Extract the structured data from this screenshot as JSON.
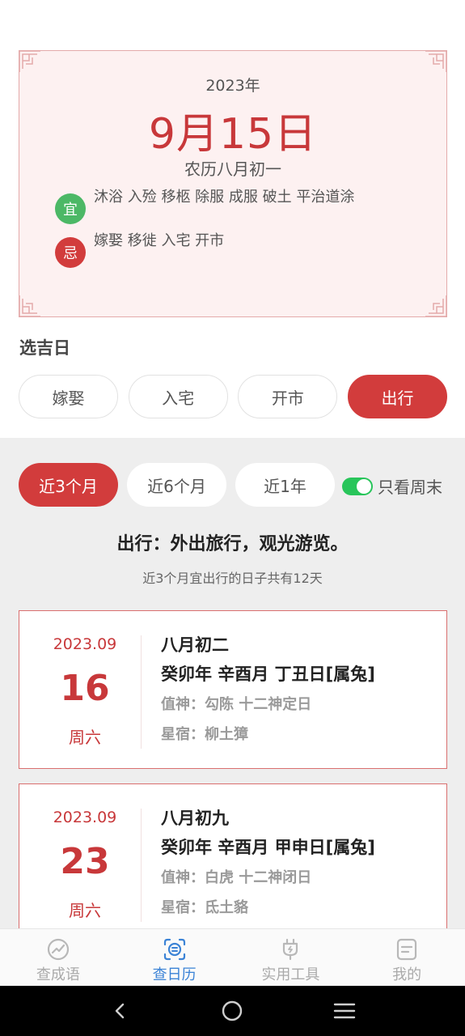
{
  "calendar": {
    "year": "2023年",
    "date": "9月15日",
    "lunar": "农历八月初一",
    "yi_label": "宜",
    "yi_text": "沐浴 入殓 移柩 除服 成服 破土 平治道涂",
    "ji_label": "忌",
    "ji_text": "嫁娶 移徙 入宅 开市"
  },
  "choose": {
    "title": "选吉日",
    "categories": [
      "嫁娶",
      "入宅",
      "开市",
      "出行"
    ],
    "active_category": "出行"
  },
  "filter": {
    "ranges": [
      "近3个月",
      "近6个月",
      "近1年"
    ],
    "active_range": "近3个月",
    "weekend_only_label": "只看周末",
    "weekend_only": true
  },
  "result": {
    "headline": "出行：外出旅行，观光游览。",
    "summary": "近3个月宜出行的日子共有12天"
  },
  "days": [
    {
      "month": "2023.09",
      "day": "16",
      "weekday": "周六",
      "lunar": "八月初二",
      "ganzhi": "癸卯年 辛酉月 丁丑日[属兔]",
      "shen": "值神：勾陈   十二神定日",
      "xiu": "星宿：柳土獐"
    },
    {
      "month": "2023.09",
      "day": "23",
      "weekday": "周六",
      "lunar": "八月初九",
      "ganzhi": "癸卯年 辛酉月 甲申日[属兔]",
      "shen": "值神：白虎   十二神闭日",
      "xiu": "星宿：氐土貉"
    }
  ],
  "nav": [
    {
      "label": "查成语",
      "icon": "trend-icon",
      "active": false
    },
    {
      "label": "查日历",
      "icon": "calendar-scan-icon",
      "active": true
    },
    {
      "label": "实用工具",
      "icon": "plug-icon",
      "active": false
    },
    {
      "label": "我的",
      "icon": "profile-card-icon",
      "active": false
    }
  ],
  "colors": {
    "accent_red": "#d23c3c",
    "accent_green": "#4cb866",
    "nav_active": "#3b83d6"
  }
}
